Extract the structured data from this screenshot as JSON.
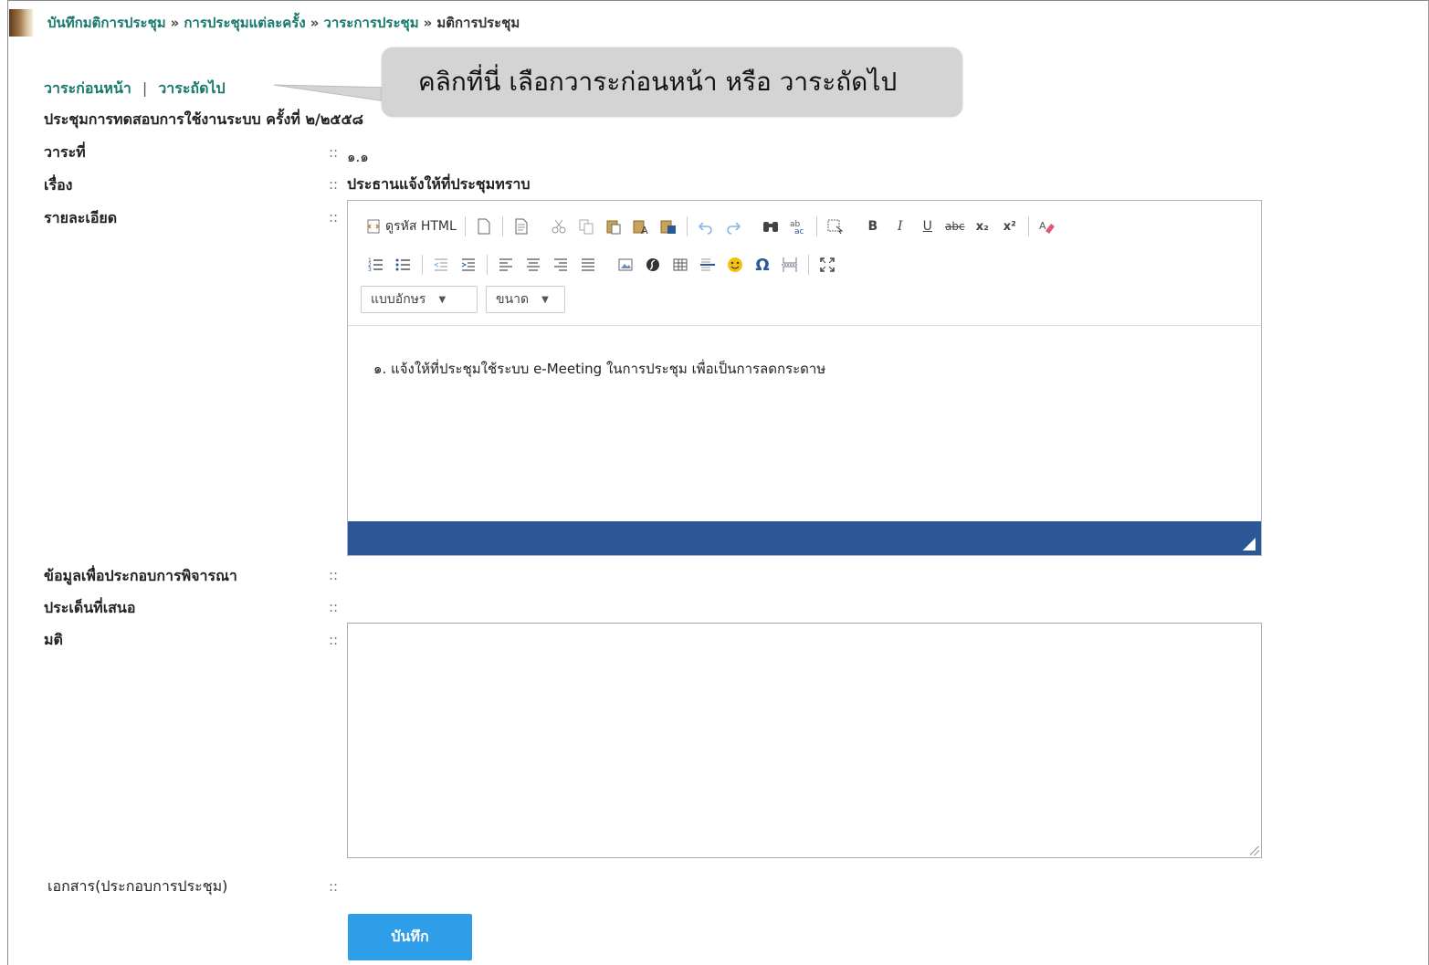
{
  "breadcrumb": {
    "items": [
      "บันทึกมติการประชุม",
      "การประชุมแต่ละครั้ง",
      "วาระการประชุม"
    ],
    "separator": "»",
    "current": "มติการประชุม"
  },
  "nav": {
    "prev_label": "วาระก่อนหน้า",
    "divider": "|",
    "next_label": "วาระถัดไป"
  },
  "callout": {
    "text": "คลิกที่นี่ เลือกวาระก่อนหน้า หรือ วาระถัดไป"
  },
  "meeting": {
    "title": "ประชุมการทดสอบการใช้งานระบบ ครั้งที่ ๒/๒๕๕๘"
  },
  "form": {
    "colon": "::",
    "agenda_no_label": "วาระที่",
    "agenda_no_value": "๑.๑",
    "subject_label": "เรื่อง",
    "subject_value": "ประธานแจ้งให้ที่ประชุมทราบ",
    "detail_label": "รายละเอียด",
    "consider_label": "ข้อมูลเพื่อประกอบการพิจารณา",
    "issue_label": "ประเด็นที่เสนอ",
    "resolution_label": "มติ",
    "resolution_value": "",
    "documents_label": "เอกสาร(ประกอบการประชุม)",
    "save_label": "บันทึก"
  },
  "editor": {
    "source_label": "ดูรหัส HTML",
    "font_dropdown": "แบบอักษร",
    "size_dropdown": "ขนาด",
    "content": "๑. แจ้งให้ที่ประชุมใช้ระบบ e-Meeting ในการประชุม เพื่อเป็นการลดกระดาษ",
    "footer_color": "#2b5797",
    "toolbar_glyphs": {
      "bold": "B",
      "italic": "I",
      "underline": "U",
      "strike": "abc",
      "subscript": "x₂",
      "superscript": "x²",
      "omega": "Ω"
    }
  },
  "colors": {
    "link": "#18796c",
    "button": "#2f9ee8",
    "callout_bg": "#d4d4d4"
  }
}
